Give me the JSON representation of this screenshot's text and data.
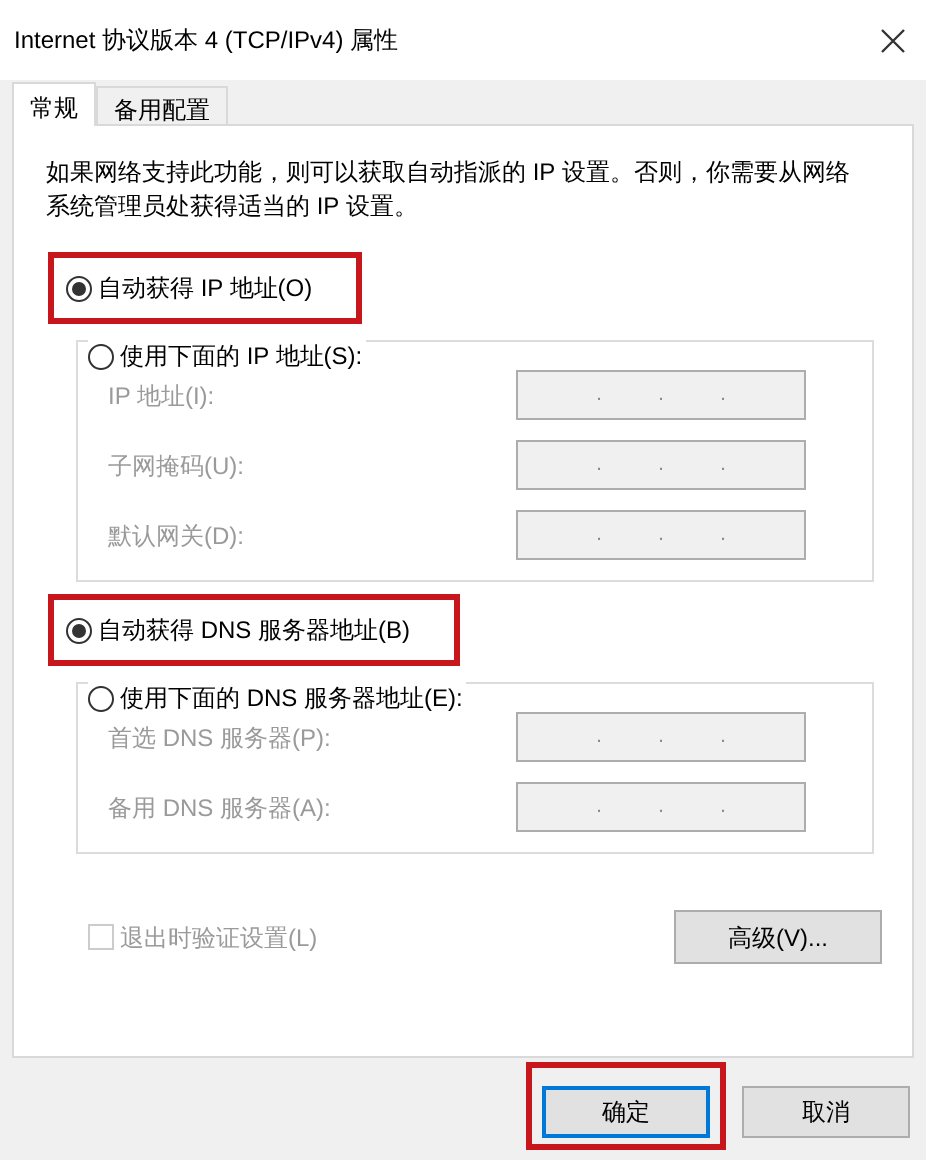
{
  "window": {
    "title": "Internet 协议版本 4 (TCP/IPv4) 属性"
  },
  "tabs": [
    {
      "label": "常规",
      "selected": true
    },
    {
      "label": "备用配置",
      "selected": false
    }
  ],
  "description": "如果网络支持此功能，则可以获取自动指派的 IP 设置。否则，你需要从网络系统管理员处获得适当的 IP 设置。",
  "ip_section": {
    "auto_option": {
      "label": "自动获得 IP 地址(O)",
      "selected": true,
      "highlighted": true
    },
    "manual_option": {
      "label": "使用下面的 IP 地址(S):",
      "selected": false
    },
    "fields": [
      {
        "label": "IP 地址(I):",
        "separators": [
          ".",
          ".",
          "."
        ],
        "disabled": true
      },
      {
        "label": "子网掩码(U):",
        "separators": [
          ".",
          ".",
          "."
        ],
        "disabled": true
      },
      {
        "label": "默认网关(D):",
        "separators": [
          ".",
          ".",
          "."
        ],
        "disabled": true
      }
    ]
  },
  "dns_section": {
    "auto_option": {
      "label": "自动获得 DNS 服务器地址(B)",
      "selected": true,
      "highlighted": true
    },
    "manual_option": {
      "label": "使用下面的 DNS 服务器地址(E):",
      "selected": false
    },
    "fields": [
      {
        "label": "首选 DNS 服务器(P):",
        "separators": [
          ".",
          ".",
          "."
        ],
        "disabled": true
      },
      {
        "label": "备用 DNS 服务器(A):",
        "separators": [
          ".",
          ".",
          "."
        ],
        "disabled": true
      }
    ]
  },
  "validate_checkbox": {
    "label": "退出时验证设置(L)",
    "checked": false,
    "disabled": true
  },
  "advanced_button": "高级(V)...",
  "buttons": [
    {
      "label": "确定",
      "highlighted": true,
      "default": true
    },
    {
      "label": "取消",
      "highlighted": false,
      "default": false
    }
  ]
}
